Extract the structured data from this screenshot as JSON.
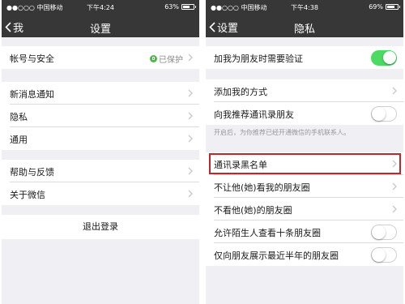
{
  "left": {
    "status": {
      "carrier": "●●○○○ 中国移动",
      "time": "下午4:24",
      "battery": "63%",
      "battery_level": 0.63
    },
    "nav": {
      "back": "我",
      "title": "设置"
    },
    "account": {
      "label": "帐号与安全",
      "value": "已保护"
    },
    "group2": [
      {
        "label": "新消息通知"
      },
      {
        "label": "隐私"
      },
      {
        "label": "通用"
      }
    ],
    "group3": [
      {
        "label": "帮助与反馈"
      },
      {
        "label": "关于微信"
      }
    ],
    "logout": "退出登录"
  },
  "right": {
    "status": {
      "carrier": "●●○○○ 中国移动",
      "time": "下午4:38",
      "battery": "69%",
      "battery_level": 0.69
    },
    "nav": {
      "back": "设置",
      "title": "隐私"
    },
    "verify": {
      "label": "加我为朋友时需要验证",
      "on": true
    },
    "group2": {
      "add_method": "添加我的方式",
      "recommend": "向我推荐通讯录朋友",
      "recommend_on": false
    },
    "note": "开启后，为你推荐已经开通微信的手机联系人。",
    "group3": {
      "blacklist": "通讯录黑名单",
      "hide_moments": "不让他(她)看我的朋友圈",
      "not_view": "不看他(她)的朋友圈",
      "strangers": "允许陌生人查看十条朋友圈",
      "strangers_on": false,
      "half_year": "仅向朋友展示最近半年的朋友圈",
      "half_year_on": false
    }
  },
  "colors": {
    "bar": "#373737",
    "toggle_on": "#4cd964",
    "highlight": "#c0272d",
    "protect": "#4cb846"
  }
}
